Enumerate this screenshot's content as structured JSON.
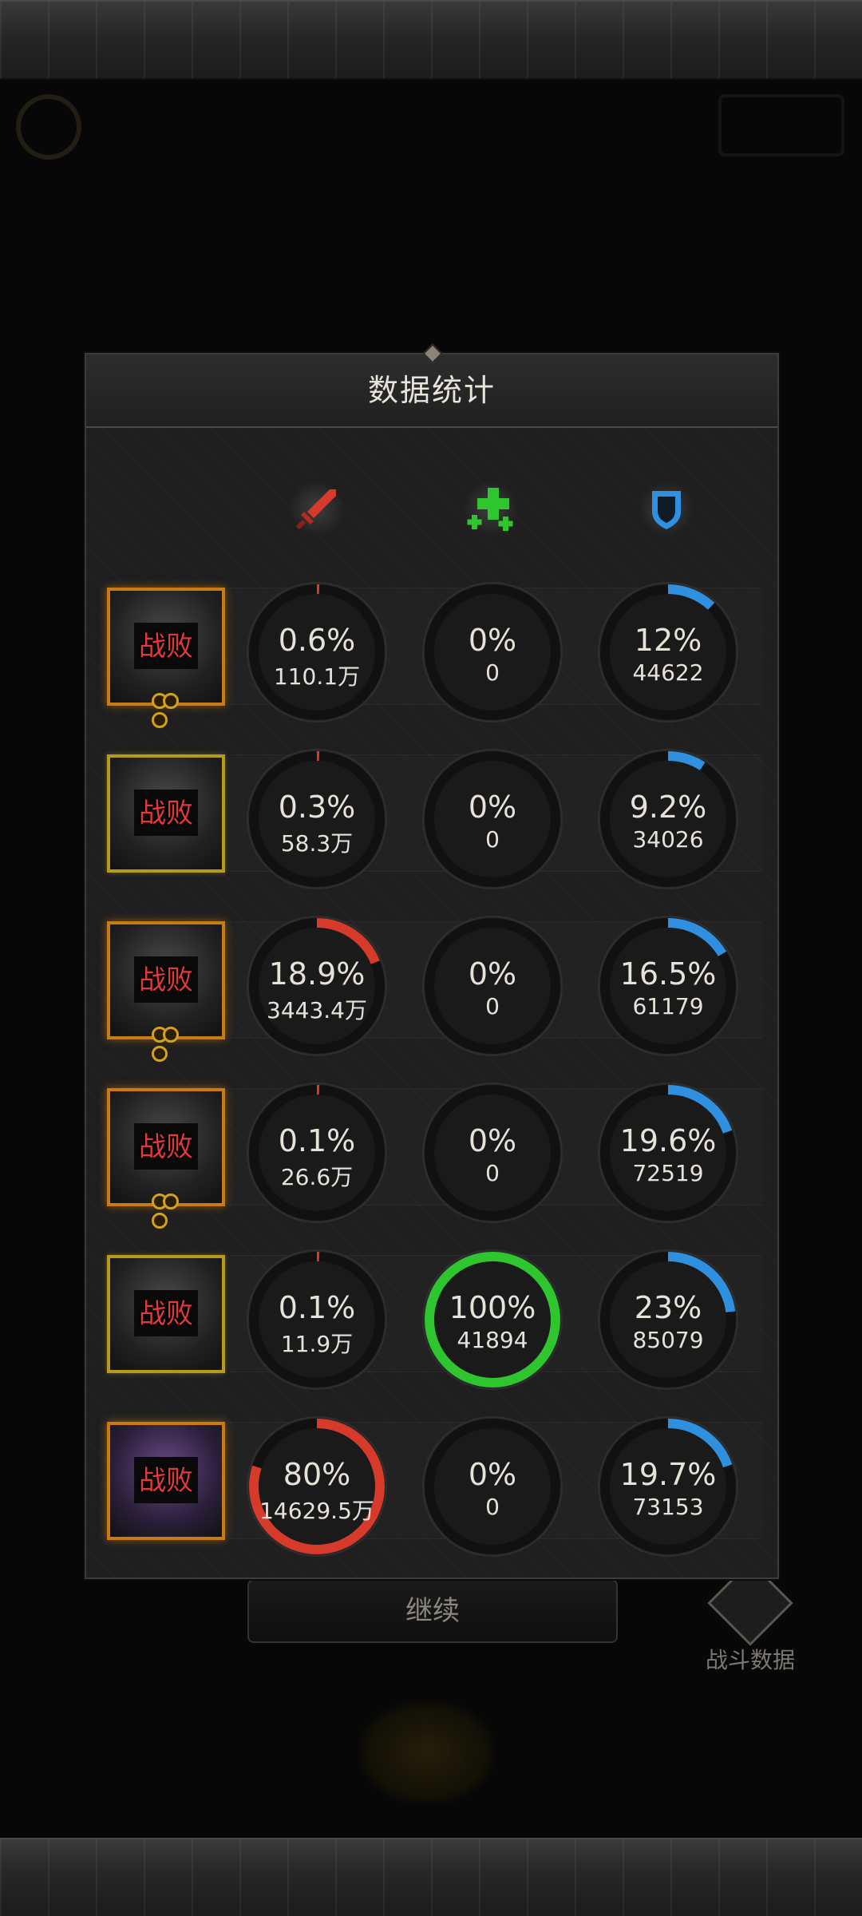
{
  "panel": {
    "title": "数据统计"
  },
  "columns": [
    {
      "icon": "sword-icon",
      "color": "#d63a2a"
    },
    {
      "icon": "heal-plus-icon",
      "color": "#2fc52f"
    },
    {
      "icon": "shield-icon",
      "color": "#2f90e0"
    }
  ],
  "rows": [
    {
      "status": "战败",
      "frame": "orange",
      "stats": [
        {
          "pct": "0.6%",
          "value": "110.1万",
          "fraction": 0.006
        },
        {
          "pct": "0%",
          "value": "0",
          "fraction": 0
        },
        {
          "pct": "12%",
          "value": "44622",
          "fraction": 0.12
        }
      ]
    },
    {
      "status": "战败",
      "frame": "gold",
      "stats": [
        {
          "pct": "0.3%",
          "value": "58.3万",
          "fraction": 0.003
        },
        {
          "pct": "0%",
          "value": "0",
          "fraction": 0
        },
        {
          "pct": "9.2%",
          "value": "34026",
          "fraction": 0.092
        }
      ]
    },
    {
      "status": "战败",
      "frame": "orange",
      "stats": [
        {
          "pct": "18.9%",
          "value": "3443.4万",
          "fraction": 0.189
        },
        {
          "pct": "0%",
          "value": "0",
          "fraction": 0
        },
        {
          "pct": "16.5%",
          "value": "61179",
          "fraction": 0.165
        }
      ]
    },
    {
      "status": "战败",
      "frame": "orange",
      "stats": [
        {
          "pct": "0.1%",
          "value": "26.6万",
          "fraction": 0.001
        },
        {
          "pct": "0%",
          "value": "0",
          "fraction": 0
        },
        {
          "pct": "19.6%",
          "value": "72519",
          "fraction": 0.196
        }
      ]
    },
    {
      "status": "战败",
      "frame": "gold",
      "stats": [
        {
          "pct": "0.1%",
          "value": "11.9万",
          "fraction": 0.001
        },
        {
          "pct": "100%",
          "value": "41894",
          "fraction": 1.0
        },
        {
          "pct": "23%",
          "value": "85079",
          "fraction": 0.23
        }
      ]
    },
    {
      "status": "战败",
      "frame": "purple",
      "stats": [
        {
          "pct": "80%",
          "value": "14629.5万",
          "fraction": 0.8
        },
        {
          "pct": "0%",
          "value": "0",
          "fraction": 0
        },
        {
          "pct": "19.7%",
          "value": "73153",
          "fraction": 0.197
        }
      ]
    }
  ],
  "continue_label": "继续",
  "battle_data_label": "战斗数据"
}
